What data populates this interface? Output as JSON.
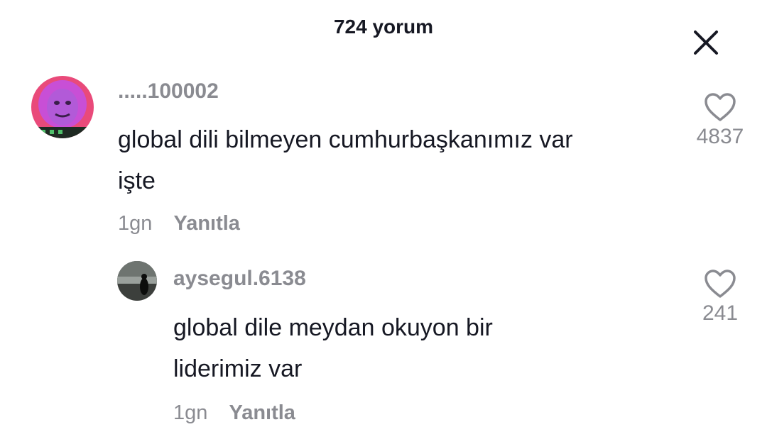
{
  "header": {
    "title": "724 yorum",
    "close_icon": "close-icon"
  },
  "comments": [
    {
      "username": ".....100002",
      "text_line1": "global dili bilmeyen cumhurbaşkanımız var",
      "text_line2": "işte",
      "time": "1gn",
      "reply_label": "Yanıtla",
      "like_count": "4837",
      "avatar_colors": {
        "primary": "#c84fd6",
        "secondary": "#e94a7a"
      }
    },
    {
      "username": "aysegul.6138",
      "text_line1": "global dile meydan okuyon bir",
      "text_line2": "liderimiz var",
      "time": "1gn",
      "reply_label": "Yanıtla",
      "like_count": "241",
      "avatar_colors": {
        "primary": "#3c3f3c",
        "secondary": "#9aa09c"
      }
    }
  ],
  "colors": {
    "text": "#161823",
    "muted": "#8a8b91",
    "background": "#ffffff"
  }
}
